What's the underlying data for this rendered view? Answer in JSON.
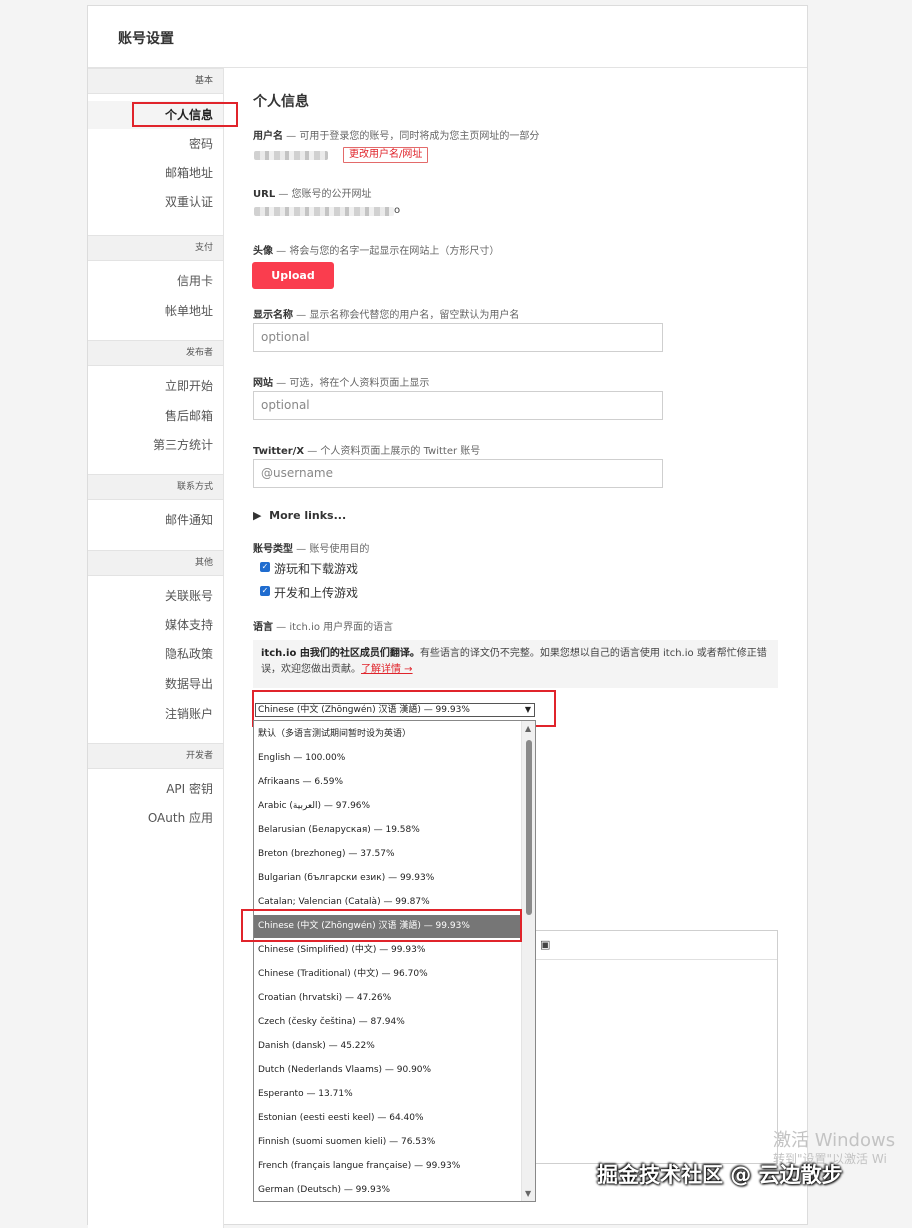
{
  "header": {
    "title": "账号设置"
  },
  "sidebar": {
    "sections": [
      {
        "heading": "基本",
        "items": [
          "个人信息",
          "密码",
          "邮箱地址",
          "双重认证"
        ]
      },
      {
        "heading": "支付",
        "items": [
          "信用卡",
          "帐单地址"
        ]
      },
      {
        "heading": "发布者",
        "items": [
          "立即开始",
          "售后邮箱",
          "第三方统计"
        ]
      },
      {
        "heading": "联系方式",
        "items": [
          "邮件通知"
        ]
      },
      {
        "heading": "其他",
        "items": [
          "关联账号",
          "媒体支持",
          "隐私政策",
          "数据导出",
          "注销账户"
        ]
      },
      {
        "heading": "开发者",
        "items": [
          "API 密钥",
          "OAuth 应用"
        ]
      }
    ]
  },
  "main": {
    "title": "个人信息",
    "username": {
      "label": "用户名",
      "desc": " — 可用于登录您的账号，同时将成为您主页网址的一部分",
      "change_button": "更改用户名/网址"
    },
    "url": {
      "label": "URL",
      "desc": " — 您账号的公开网址",
      "suffix": "o"
    },
    "avatar": {
      "label": "头像",
      "desc": " — 将会与您的名字一起显示在网站上（方形尺寸）",
      "upload_button": "Upload image"
    },
    "display_name": {
      "label": "显示名称",
      "desc": " — 显示名称会代替您的用户名，留空默认为用户名",
      "placeholder": "optional"
    },
    "website": {
      "label": "网站",
      "desc": " — 可选，将在个人资料页面上显示",
      "placeholder": "optional"
    },
    "twitter": {
      "label": "Twitter/X",
      "desc": " — 个人资料页面上展示的 Twitter 账号",
      "placeholder": "@username"
    },
    "more_links": "More links...",
    "account_type": {
      "label": "账号类型",
      "desc": " — 账号使用目的",
      "options": [
        "游玩和下载游戏",
        "开发和上传游戏"
      ]
    },
    "language": {
      "label": "语言",
      "desc": " — itch.io 用户界面的语言",
      "note_bold": "itch.io 由我们的社区成员们翻译。",
      "note_text": "有些语言的译文仍不完整。如果您想以自己的语言使用 itch.io 或者帮忙修正错误，欢迎您做出贡献。",
      "note_link": "了解详情 →",
      "selected": "Chinese (中文 (Zhōngwén) 汉语 漢語) — 99.93%",
      "options": [
        "默认（多语言测试期间暂时设为英语）",
        "English — 100.00%",
        "Afrikaans — 6.59%",
        "Arabic (العربية) — 97.96%",
        "Belarusian (Беларуская) — 19.58%",
        "Breton (brezhoneg) — 37.57%",
        "Bulgarian (български език) — 99.93%",
        "Catalan; Valencian (Català) — 99.87%",
        "Chinese (中文 (Zhōngwén) 汉语 漢語) — 99.93%",
        "Chinese (Simplified) (中文) — 99.93%",
        "Chinese (Traditional) (中文) — 96.70%",
        "Croatian (hrvatski) — 47.26%",
        "Czech (česky čeština) — 87.94%",
        "Danish (dansk) — 45.22%",
        "Dutch (Nederlands Vlaams) — 90.90%",
        "Esperanto — 13.71%",
        "Estonian (eesti eesti keel) — 64.40%",
        "Finnish (suomi suomen kieli) — 76.53%",
        "French (français langue française) — 99.93%",
        "German (Deutsch) — 99.93%"
      ],
      "selected_index": 8
    }
  },
  "overlay": {
    "windows_line1": "激活 Windows",
    "windows_line2": "转到\"设置\"以激活 Wi",
    "credit": "掘金技术社区 @ 云边散步"
  },
  "colors": {
    "accent": "#fa3d4e",
    "highlight_box": "#e0242b",
    "checkbox": "#1f6ccf"
  }
}
